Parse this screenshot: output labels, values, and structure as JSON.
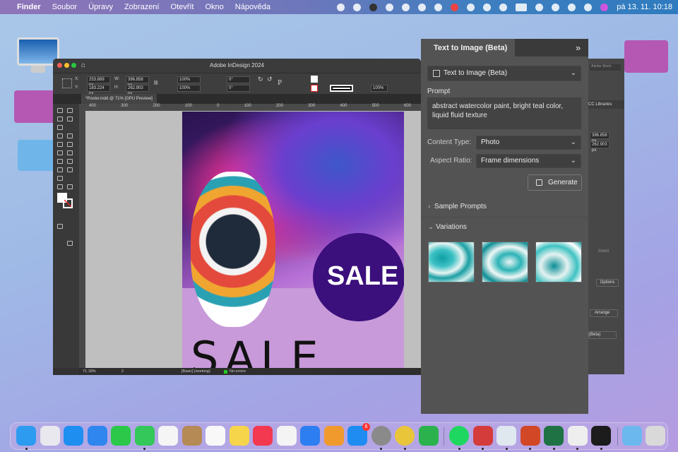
{
  "menubar": {
    "apple": "",
    "app": "Finder",
    "items": [
      "Soubor",
      "Úpravy",
      "Zobrazení",
      "Otevřít",
      "Okno",
      "Nápověda"
    ],
    "clock": "pá 13. 11.  10:18"
  },
  "indesign": {
    "title": "Adobe InDesign 2024",
    "control": {
      "x_label": "X:",
      "x": "253.889 px",
      "y_label": "Y:",
      "y": "183.224 px",
      "w_label": "W:",
      "w": "396.858 px",
      "h_label": "H:",
      "h": "262.903 px",
      "scale_x": "100%",
      "scale_y": "100%",
      "rotate": "0°",
      "shear": "0°",
      "opacity": "100%"
    },
    "doc_tab": "*Poster.indd @ 71% [GPU Preview]",
    "ruler": [
      "400",
      "300",
      "200",
      "100",
      "0",
      "100",
      "200",
      "300",
      "400",
      "500",
      "600"
    ],
    "poster": {
      "circle_text": "SALE",
      "big_text": "SALE"
    },
    "status": {
      "zoom": "71.18%",
      "page": "2",
      "preflight_profile": "[Basic] (working)",
      "errors": "No errors"
    }
  },
  "right_strip": {
    "search": "Adobe Stock",
    "libraries": "CC Libraries",
    "w": "396.858 px",
    "h": "262.903 px",
    "invert": "Invert",
    "options": "Options",
    "arrange": "Arrange",
    "beta": "(Beta)"
  },
  "t2i": {
    "tab": "Text to Image (Beta)",
    "collapse": "»",
    "mode": "Text to Image (Beta)",
    "prompt_label": "Prompt",
    "prompt": "abstract watercolor paint, bright teal color, liquid fluid texture",
    "content_type_label": "Content Type:",
    "content_type": "Photo",
    "aspect_label": "Aspect Ratio:",
    "aspect": "Frame dimensions",
    "generate": "Generate",
    "sample_prompts": "Sample Prompts",
    "variations": "Variations"
  },
  "dock": {
    "badge": "6",
    "apps": [
      {
        "name": "finder",
        "color": "#2d9bf0"
      },
      {
        "name": "launchpad",
        "color": "#e8e8ee"
      },
      {
        "name": "safari",
        "color": "#1e8ef0"
      },
      {
        "name": "mail",
        "color": "#2f86ef"
      },
      {
        "name": "facetime",
        "color": "#2bc84a"
      },
      {
        "name": "messages",
        "color": "#34c759"
      },
      {
        "name": "photos",
        "color": "#f5f5f5"
      },
      {
        "name": "contacts",
        "color": "#b58a55"
      },
      {
        "name": "reminders",
        "color": "#f8f8f8"
      },
      {
        "name": "notes",
        "color": "#f7d54a"
      },
      {
        "name": "music",
        "color": "#f2394f"
      },
      {
        "name": "numbers",
        "color": "#f4f4f4"
      },
      {
        "name": "keynote",
        "color": "#2d7ef0"
      },
      {
        "name": "pages",
        "color": "#f09a2e"
      },
      {
        "name": "app-store",
        "color": "#1f8cf2"
      },
      {
        "name": "system-preferences",
        "color": "#8a8a8a"
      },
      {
        "name": "chrome",
        "color": "#e9c53a"
      },
      {
        "name": "feedly",
        "color": "#2bb24c"
      },
      {
        "name": "spotify",
        "color": "#1ed760"
      },
      {
        "name": "parallels",
        "color": "#d43c3c"
      },
      {
        "name": "preview",
        "color": "#dfe7ef"
      },
      {
        "name": "powerpoint",
        "color": "#d24726"
      },
      {
        "name": "excel",
        "color": "#1f7244"
      },
      {
        "name": "signature",
        "color": "#eeeeee"
      },
      {
        "name": "terminal",
        "color": "#1c1c1c"
      },
      {
        "name": "downloads-folder",
        "color": "#6bb8ef"
      },
      {
        "name": "trash",
        "color": "#d9d9d9"
      }
    ]
  }
}
